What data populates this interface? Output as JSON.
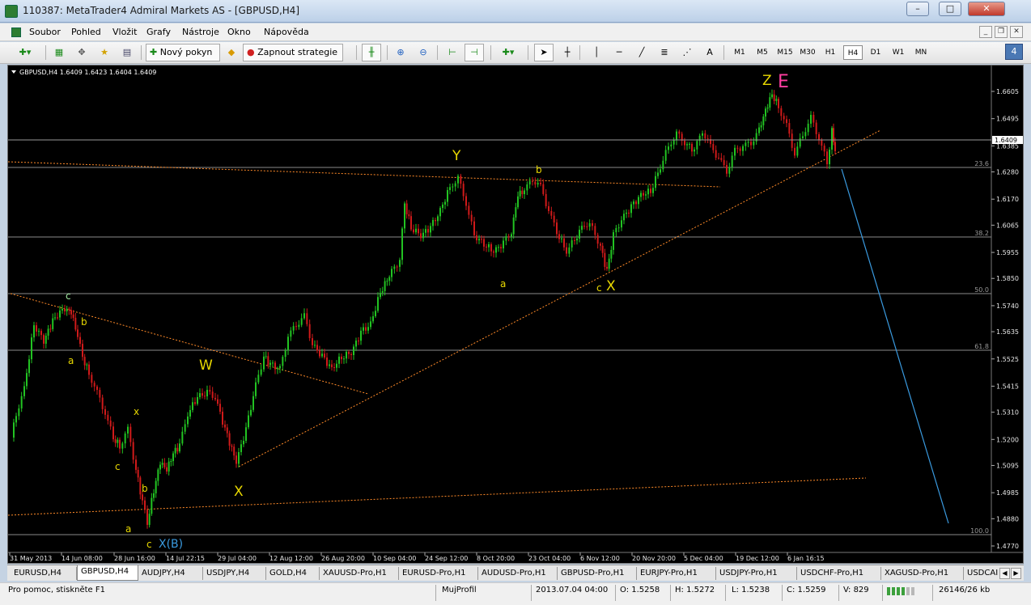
{
  "window": {
    "title": "110387: MetaTrader4 Admiral Markets AS - [GBPUSD,H4]",
    "minimize": "–",
    "maximize": "□",
    "close": "✕"
  },
  "menu": [
    "Soubor",
    "Pohled",
    "Vložit",
    "Grafy",
    "Nástroje",
    "Okno",
    "Nápověda"
  ],
  "toolbar": {
    "new_order": "Nový pokyn",
    "strategies": "Zapnout strategie",
    "timeframes": [
      "M1",
      "M5",
      "M15",
      "M30",
      "H1",
      "H4",
      "D1",
      "W1",
      "MN"
    ],
    "active_timeframe": "H4",
    "notification_badge": "4"
  },
  "chart": {
    "header": "GBPUSD,H4  1.6409 1.6423 1.6404 1.6409",
    "current_price": "1.6409",
    "price_labels": [
      "1.6605",
      "1.6495",
      "1.6385",
      "1.6280",
      "1.6170",
      "1.6065",
      "1.5955",
      "1.5850",
      "1.5740",
      "1.5635",
      "1.5525",
      "1.5415",
      "1.5310",
      "1.5200",
      "1.5095",
      "1.4985",
      "1.4880",
      "1.4770"
    ],
    "time_labels": [
      "31 May 2013",
      "14 Jun 08:00",
      "28 Jun 16:00",
      "14 Jul 22:15",
      "29 Jul 04:00",
      "12 Aug 12:00",
      "26 Aug 20:00",
      "10 Sep 04:00",
      "24 Sep 12:00",
      "8 Oct 20:00",
      "23 Oct 04:00",
      "6 Nov 12:00",
      "20 Nov 20:00",
      "5 Dec 04:00",
      "19 Dec 12:00",
      "6 Jan 16:15"
    ],
    "fib_levels": [
      "23.6",
      "38.2",
      "50.0",
      "61.8",
      "100.0"
    ],
    "wave_labels": {
      "c1": "c",
      "b1": "b",
      "a1": "a",
      "x1": "x",
      "c2": "c",
      "b2": "b",
      "a2": "a",
      "c3": "c",
      "xb": "X(B)",
      "W": "W",
      "X1": "X",
      "Y": "Y",
      "a3": "a",
      "b3": "b",
      "c4": "c",
      "X2": "X",
      "Z": "Z",
      "E": "E"
    }
  },
  "tabs": [
    "EURUSD,H4",
    "GBPUSD,H4",
    "AUDJPY,H4",
    "USDJPY,H4",
    "GOLD,H4",
    "XAUUSD-Pro,H1",
    "EURUSD-Pro,H1",
    "AUDUSD-Pro,H1",
    "GBPUSD-Pro,H1",
    "EURJPY-Pro,H1",
    "USDJPY-Pro,H1",
    "USDCHF-Pro,H1",
    "XAGUSD-Pro,H1",
    "USDCAI"
  ],
  "active_tab": "GBPUSD,H4",
  "status": {
    "help": "Pro pomoc, stiskněte F1",
    "profile": "MujProfil",
    "datetime": "2013.07.04 04:00",
    "open": "O: 1.5258",
    "high": "H: 1.5272",
    "low": "L: 1.5238",
    "close": "C: 1.5259",
    "volume": "V: 829",
    "traffic": "26146/26 kb"
  },
  "colors": {
    "bull": "#22c322",
    "bear": "#d01a1a",
    "wave_label": "#e8d800",
    "magenta": "#ff3da0",
    "trend_line": "#ff8a28",
    "projection": "#3a9adf"
  }
}
